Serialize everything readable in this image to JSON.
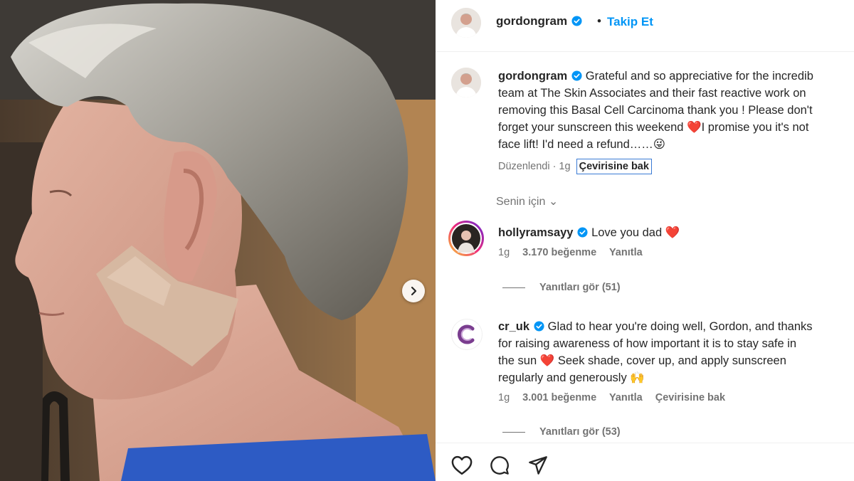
{
  "post": {
    "author": "gordongram",
    "follow_label": "Takip Et",
    "header_separator": "•",
    "caption": {
      "line1": "Grateful and so appreciative for the incredib",
      "line2": "team at The Skin Associates and their fast reactive work on",
      "line3": "removing this Basal Cell Carcinoma thank you ! Please don't",
      "line4": "forget your sunscreen this weekend ❤️I promise you it's not",
      "line5": "face lift! I'd need a refund……😜"
    },
    "edited_label": "Düzenlendi · 1g",
    "see_translation": "Çevirisine bak"
  },
  "filter_label": "Senin için ⌄",
  "comments": [
    {
      "user": "hollyramsayy",
      "text": "Love you dad ❤️",
      "age": "1g",
      "likes": "3.170 beğenme",
      "reply_label": "Yanıtla",
      "view_replies": "Yanıtları gör (51)"
    },
    {
      "user": "cr_uk",
      "line1": "Glad to hear you're doing well, Gordon, and thanks",
      "line2": "for raising awareness of how important it is to stay safe in",
      "line3": "the sun ❤️ Seek shade, cover up, and apply sunscreen",
      "line4": "regularly and generously 🙌",
      "age": "1g",
      "likes": "3.001 beğenme",
      "reply_label": "Yanıtla",
      "translate_label": "Çevirisine bak",
      "view_replies": "Yanıtları gör (53)"
    }
  ],
  "icons": [
    "verified-badge-icon",
    "chevron-right-icon",
    "heart-icon",
    "comment-icon",
    "share-icon"
  ],
  "colors": {
    "verified": "#0095f6",
    "follow": "#0095f6",
    "translation_focus": "#3a7bd5"
  }
}
